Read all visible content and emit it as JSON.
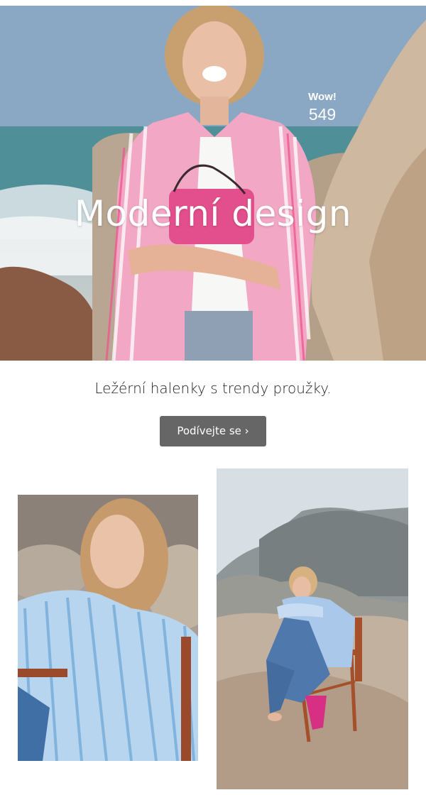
{
  "hero": {
    "title": "Moderní design",
    "badge": {
      "label": "Wow!",
      "count": "549"
    },
    "image_icon": "hero-photo-woman-pink-shirt"
  },
  "tagline": "Ležérní halenky s trendy proužky.",
  "cta": {
    "label": "Podívejte se ›",
    "color": "#666666"
  },
  "gallery": {
    "left_icon": "photo-woman-blue-striped-shirt",
    "right_icon": "photo-woman-seated-on-rocks"
  }
}
